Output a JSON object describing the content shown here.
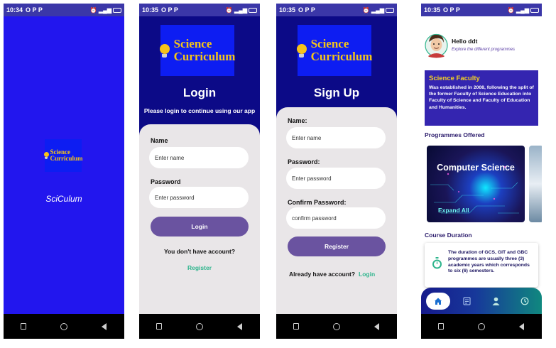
{
  "screens": {
    "splash": {
      "status_time": "10:34",
      "status_icons": "O P P",
      "logo_line1": "Science",
      "logo_line2": "Curriculum",
      "app_name": "SciCulum"
    },
    "login": {
      "status_time": "10:35",
      "status_icons": "O P P",
      "logo_line1": "Science",
      "logo_line2": "Curriculum",
      "title": "Login",
      "subtitle": "Please login to continue using our app",
      "name_label": "Name",
      "name_placeholder": "Enter name",
      "password_label": "Password",
      "password_placeholder": "Enter password",
      "login_button": "Login",
      "prompt": "You don't have account?",
      "register_link": "Register"
    },
    "signup": {
      "status_time": "10:35",
      "status_icons": "O P P",
      "logo_line1": "Science",
      "logo_line2": "Curriculum",
      "title": "Sign Up",
      "name_label": "Name:",
      "name_placeholder": "Enter name",
      "password_label": "Password:",
      "password_placeholder": "Enter password",
      "confirm_label": "Confirm Password:",
      "confirm_placeholder": "confirm password",
      "register_button": "Register",
      "prompt": "Already have account?",
      "login_link": "Login"
    },
    "home": {
      "status_time": "10:35",
      "status_icons": "O P P",
      "greeting": "Hello ddt",
      "subtitle": "Explore the different programmes",
      "faculty_title": "Science Faculty",
      "faculty_text": "Was established in 2008, following the split of the former Faculty of Science Education into Faculty of Science and Faculty of Education and Humanities.",
      "programmes_heading": "Programmes Offered",
      "programme_card_title": "Computer Science",
      "programme_card_action": "Expand All",
      "duration_heading": "Course Duration",
      "duration_text": "The duration of GCS, GIT and GBC programmes are usually three (3) academic years which corresponds to six (6) semesters.",
      "bottom_nav": [
        "home-icon",
        "courses-icon",
        "profile-icon",
        "history-icon"
      ]
    }
  },
  "colors": {
    "splash_bg": "#2216ee",
    "auth_bg": "#0c0a87",
    "logo_bg": "#0d1df2",
    "logo_text": "#f5c518",
    "button": "#6a53a0",
    "link": "#2fb58d",
    "faculty_bg": "#3425b0"
  }
}
